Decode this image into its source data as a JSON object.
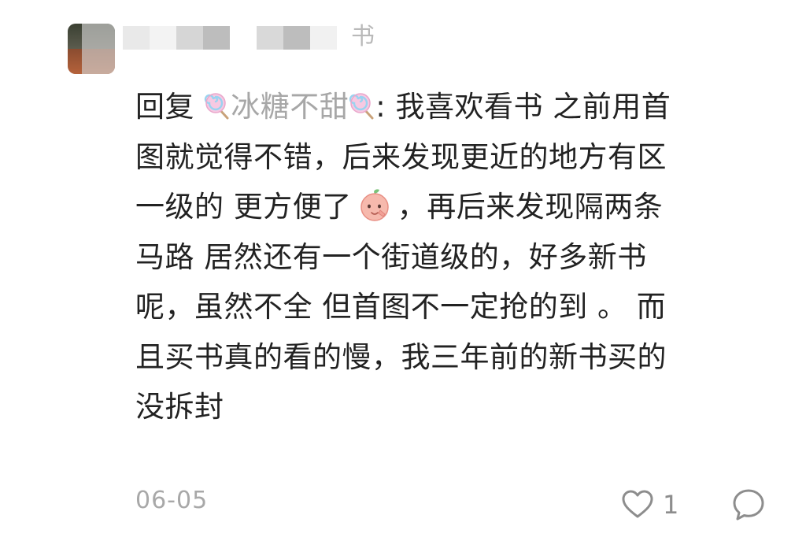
{
  "comment": {
    "author": {
      "name_tail": "书"
    },
    "lines": [
      {
        "reply_prefix": "回复",
        "reply_target": "冰糖不甜",
        "rest": ": 我喜欢看书 之前用首"
      },
      {
        "text": "图就觉得不错，后来发现更近的地方有区"
      },
      {
        "before": "一级的 更方便了",
        "after": "，再后来发现隔两条"
      },
      {
        "text": "马路 居然还有一个街道级的，好多新书"
      },
      {
        "text": "呢，虽然不全 但首图不一定抢的到 。 而"
      },
      {
        "text": "且买书真的看的慢，我三年前的新书买的"
      },
      {
        "text": "没拆封"
      }
    ],
    "date": "06-05",
    "like_count": "1"
  },
  "icons": {
    "like": "heart-outline-icon",
    "reply": "speech-bubble-icon",
    "lollipop": "lollipop-emoji",
    "peach": "peach-emoji"
  },
  "colors": {
    "text": "#222222",
    "muted": "#a8a8a8",
    "reply_target": "#a7a7a7",
    "icon": "#8d8d8d"
  }
}
